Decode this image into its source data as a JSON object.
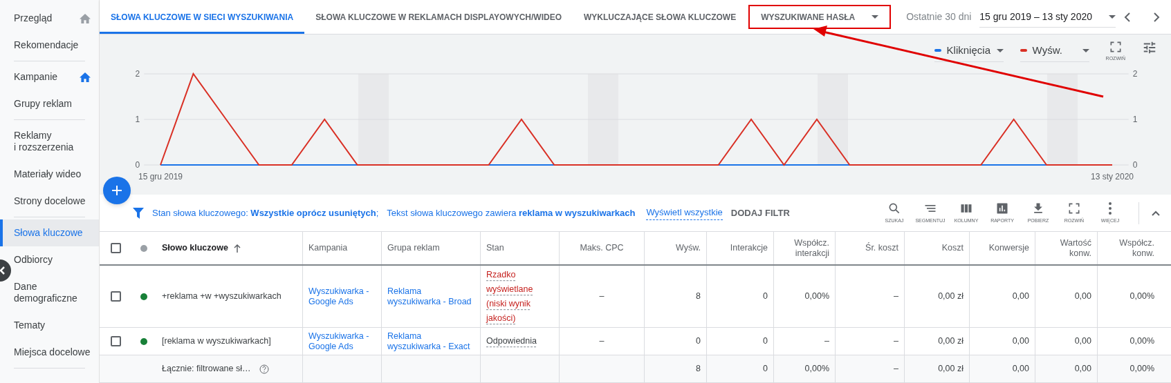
{
  "sidebar": {
    "items": [
      {
        "label": "Przegląd",
        "kind": "home",
        "selected": false,
        "icon_active": false,
        "divider_after": false
      },
      {
        "label": "Rekomendacje",
        "kind": "plain",
        "selected": false,
        "divider_after": true
      },
      {
        "label": "Kampanie",
        "kind": "home",
        "selected": false,
        "icon_active": true,
        "divider_after": false
      },
      {
        "label": "Grupy reklam",
        "kind": "plain",
        "selected": false,
        "divider_after": true
      },
      {
        "label": "Reklamy\ni rozszerzenia",
        "kind": "plain",
        "selected": false,
        "divider_after": false
      },
      {
        "label": "Materiały wideo",
        "kind": "plain",
        "selected": false,
        "divider_after": false
      },
      {
        "label": "Strony docelowe",
        "kind": "plain",
        "selected": false,
        "divider_after": true
      },
      {
        "label": "Słowa kluczowe",
        "kind": "plain",
        "selected": true,
        "divider_after": false
      },
      {
        "label": "Odbiorcy",
        "kind": "plain",
        "selected": false,
        "divider_after": false
      },
      {
        "label": "Dane\ndemograficzne",
        "kind": "plain",
        "selected": false,
        "divider_after": false
      },
      {
        "label": "Tematy",
        "kind": "plain",
        "selected": false,
        "divider_after": false
      },
      {
        "label": "Miejsca docelowe",
        "kind": "plain",
        "selected": false,
        "divider_after": true
      }
    ]
  },
  "tabs": [
    {
      "label": "SŁOWA KLUCZOWE W SIECI WYSZUKIWANIA",
      "selected": true,
      "highlighted": false,
      "dropdown": false
    },
    {
      "label": "SŁOWA KLUCZOWE W REKLAMACH DISPLAYOWYCH/WIDEO",
      "selected": false,
      "highlighted": false,
      "dropdown": false
    },
    {
      "label": "WYKLUCZAJĄCE SŁOWA KLUCZOWE",
      "selected": false,
      "highlighted": false,
      "dropdown": false
    },
    {
      "label": "WYSZUKIWANE HASŁA",
      "selected": false,
      "highlighted": true,
      "dropdown": true
    }
  ],
  "annotation_arrow": true,
  "date_range": {
    "label": "Ostatnie 30 dni",
    "value": "15 gru 2019 – 13 sty 2020"
  },
  "chart": {
    "expand_label": "ROZWIŃ",
    "right_axis_labels": [
      "2",
      "1",
      "0"
    ],
    "chart_data": {
      "type": "line",
      "categories": [
        "15 gru 2019",
        null,
        null,
        null,
        null,
        null,
        null,
        null,
        null,
        null,
        null,
        null,
        null,
        null,
        null,
        null,
        null,
        null,
        null,
        null,
        null,
        null,
        null,
        null,
        null,
        null,
        null,
        null,
        null,
        "13 sty 2020"
      ],
      "ylim": [
        0,
        2
      ],
      "yticks": [
        {
          "value": 0,
          "label": "0"
        },
        {
          "value": 1,
          "label": "1"
        },
        {
          "value": 2,
          "label": "2"
        }
      ],
      "series": [
        {
          "name": "Kliknięcia",
          "color": "#1a73e8",
          "values": [
            0,
            0,
            0,
            0,
            0,
            0,
            0,
            null,
            null,
            null,
            0,
            0,
            0,
            null,
            null,
            null,
            null,
            0,
            0,
            0,
            0,
            0,
            null,
            null,
            null,
            0,
            0,
            0,
            null,
            null
          ]
        },
        {
          "name": "Wyśw.",
          "color": "#d93025",
          "values": [
            0,
            2,
            1,
            0,
            0,
            1,
            0,
            0,
            0,
            0,
            0,
            1,
            0,
            0,
            0,
            0,
            0,
            0,
            1,
            0,
            1,
            0,
            0,
            0,
            0,
            0,
            1,
            0,
            0,
            0
          ]
        }
      ]
    }
  },
  "filter": {
    "parts": [
      "Stan słowa kluczowego: **Wszystkie oprócz usuniętych**;",
      "Tekst słowa kluczowego zawiera **reklama w wyszukiwarkach**"
    ],
    "link": "Wyświetl wszystkie",
    "add_button": "DODAJ FILTR"
  },
  "toolbar": [
    {
      "label": "SZUKAJ",
      "kind": "search"
    },
    {
      "label": "SEGMENTUJ",
      "kind": "segment"
    },
    {
      "label": "KOLUMNY",
      "kind": "columns"
    },
    {
      "label": "RAPORTY",
      "kind": "reports"
    },
    {
      "label": "POBIERZ",
      "kind": "download"
    },
    {
      "label": "ROZWIŃ",
      "kind": "expand"
    },
    {
      "label": "WIĘCEJ",
      "kind": "more"
    }
  ],
  "table": {
    "header_checked": false,
    "columns": [
      {
        "label": "Słowo kluczowe",
        "sorted": true
      },
      {
        "label": "Kampania",
        "sorted": false
      },
      {
        "label": "Grupa reklam",
        "sorted": false
      },
      {
        "label": "Stan",
        "sorted": false
      },
      {
        "label": "Maks. CPC",
        "sorted": false
      },
      {
        "label": "Wyśw.",
        "sorted": false
      },
      {
        "label": "Interakcje",
        "sorted": false
      },
      {
        "label": "Współcz. interakcji",
        "sorted": false
      },
      {
        "label": "Śr. koszt",
        "sorted": false
      },
      {
        "label": "Koszt",
        "sorted": false
      },
      {
        "label": "Konwersje",
        "sorted": false
      },
      {
        "label": "Wartość konw.",
        "sorted": false
      },
      {
        "label": "Współcz. konw.",
        "sorted": false
      }
    ],
    "rows": [
      {
        "checked": false,
        "color": "#188038",
        "keyword": "+reklama +w +wyszukiwarkach",
        "campaign": "Wyszukiwarka - Google Ads",
        "ad_group": "Reklama wyszukiwarka - Broad",
        "status": {
          "text": "Rzadko wyświetlane (niski wynik jakości)",
          "kind": "warning"
        },
        "metrics": [
          "–",
          "8",
          "0",
          "0,00%",
          "–",
          "0,00 zł",
          "0,00",
          "0,00",
          "0,00%"
        ]
      },
      {
        "checked": false,
        "color": "#188038",
        "keyword": "[reklama w wyszukiwarkach]",
        "campaign": "Wyszukiwarka - Google Ads",
        "ad_group": "Reklama wyszukiwarka - Exact",
        "status": {
          "text": "Odpowiednia",
          "kind": "ok"
        },
        "metrics": [
          "–",
          "0",
          "0",
          "–",
          "–",
          "0,00 zł",
          "0,00",
          "0,00",
          "0,00%"
        ]
      }
    ],
    "total": {
      "label": "Łącznie: filtrowane sł…",
      "metrics": [
        "8",
        "0",
        "0,00%",
        "–",
        "0,00 zł",
        "0,00",
        "0,00",
        "0,00%"
      ]
    }
  }
}
